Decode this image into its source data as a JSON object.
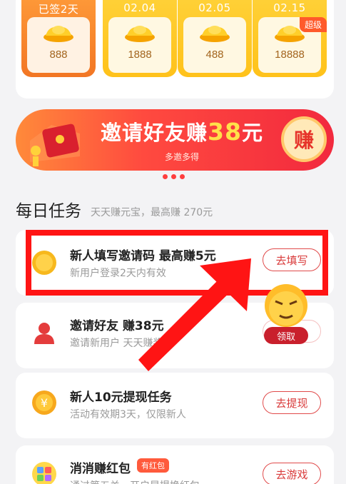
{
  "signin": {
    "days": [
      {
        "label": "已签2天",
        "value": "888"
      },
      {
        "label": "02.04",
        "value": "1888"
      },
      {
        "label": "02.05",
        "value": "488"
      },
      {
        "label": "02.15",
        "value": "18888",
        "badge": "超级"
      }
    ]
  },
  "banner": {
    "title_prefix": "邀请好友赚",
    "amount": "38",
    "title_suffix": "元",
    "subtitle": "多邀多得",
    "badge": "赚"
  },
  "daily": {
    "title": "每日任务",
    "subtitle": "天天赚元宝，最高赚 270元"
  },
  "tasks": [
    {
      "title": "新人填写邀请码  最高赚5元",
      "desc": "新用户登录2天内有效",
      "button": "去填写",
      "icon": "coin-icon"
    },
    {
      "title": "邀请好友  赚38元",
      "desc": "邀请新用户  天天赚奖金",
      "button": "领取",
      "icon": "user-icon"
    },
    {
      "title": "新人10元提现任务",
      "desc": "活动有效期3天，仅限新人",
      "button": "去提现",
      "icon": "yuan-coin-icon"
    },
    {
      "title": "消消赚红包",
      "tag": "有红包",
      "desc": "通过第五关，开启早提换红包",
      "button": "去游戏",
      "icon": "game-icon"
    }
  ],
  "colors": {
    "accent": "#e04a4a",
    "highlight": "#ff1414",
    "gold": "#ffc21a",
    "orange": "#f27624"
  }
}
